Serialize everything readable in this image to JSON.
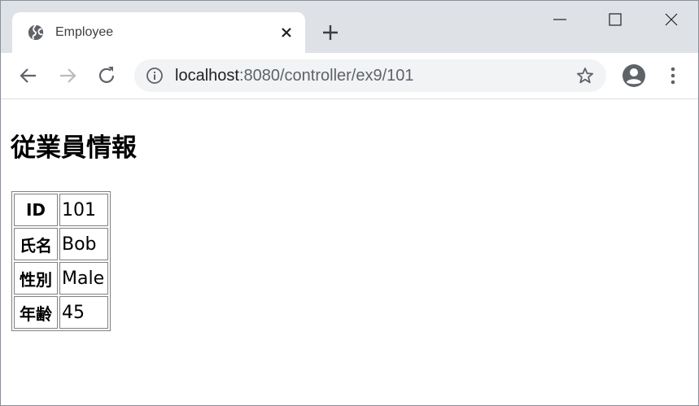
{
  "browser": {
    "tab": {
      "title": "Employee",
      "icon": "globe-icon"
    },
    "address": {
      "host": "localhost",
      "path": ":8080/controller/ex9/101"
    }
  },
  "page": {
    "heading": "従業員情報",
    "rows": [
      {
        "label": "ID",
        "value": "101"
      },
      {
        "label": "氏名",
        "value": "Bob"
      },
      {
        "label": "性別",
        "value": "Male"
      },
      {
        "label": "年齢",
        "value": "45"
      }
    ]
  }
}
